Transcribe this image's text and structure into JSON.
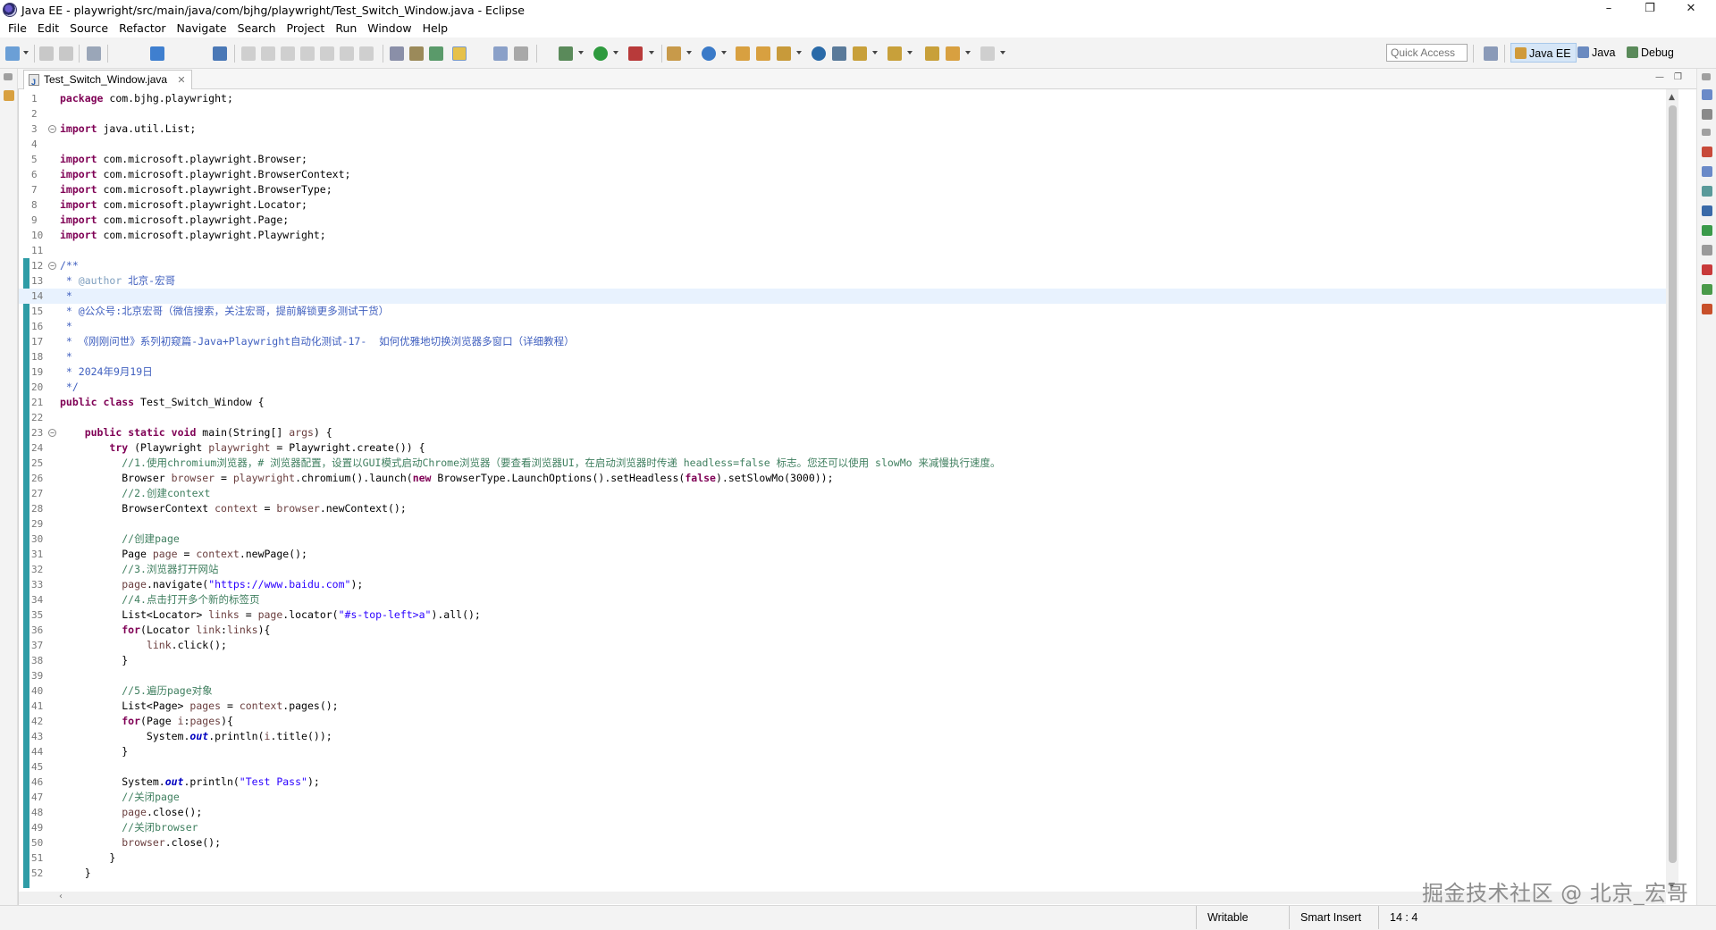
{
  "window": {
    "title": "Java EE - playwright/src/main/java/com/bjhg/playwright/Test_Switch_Window.java - Eclipse",
    "minimize_glyph": "–",
    "restore_glyph": "❐",
    "close_glyph": "✕"
  },
  "menu": [
    "File",
    "Edit",
    "Source",
    "Refactor",
    "Navigate",
    "Search",
    "Project",
    "Run",
    "Window",
    "Help"
  ],
  "toolbar": {
    "quick_access_placeholder": "Quick Access",
    "perspectives": [
      {
        "label": "Java EE",
        "icon": "java-ee-perspective-icon",
        "active": true
      },
      {
        "label": "Java",
        "icon": "java-perspective-icon",
        "active": false
      },
      {
        "label": "Debug",
        "icon": "debug-perspective-icon",
        "active": false
      }
    ]
  },
  "editor": {
    "tab_label": "Test_Switch_Window.java",
    "tab_close_glyph": "✕",
    "current_line": 14,
    "lines": [
      {
        "n": "1",
        "tokens": [
          [
            "kw",
            "package"
          ],
          [
            "",
            " com.bjhg.playwright;"
          ]
        ]
      },
      {
        "n": "2",
        "tokens": []
      },
      {
        "n": "3",
        "fold": true,
        "tokens": [
          [
            "kw",
            "import"
          ],
          [
            "",
            " java.util.List;"
          ]
        ]
      },
      {
        "n": "4",
        "tokens": []
      },
      {
        "n": "5",
        "tokens": [
          [
            "kw",
            "import"
          ],
          [
            "",
            " com.microsoft.playwright.Browser;"
          ]
        ]
      },
      {
        "n": "6",
        "tokens": [
          [
            "kw",
            "import"
          ],
          [
            "",
            " com.microsoft.playwright.BrowserContext;"
          ]
        ]
      },
      {
        "n": "7",
        "tokens": [
          [
            "kw",
            "import"
          ],
          [
            "",
            " com.microsoft.playwright.BrowserType;"
          ]
        ]
      },
      {
        "n": "8",
        "tokens": [
          [
            "kw",
            "import"
          ],
          [
            "",
            " com.microsoft.playwright.Locator;"
          ]
        ]
      },
      {
        "n": "9",
        "tokens": [
          [
            "kw",
            "import"
          ],
          [
            "",
            " com.microsoft.playwright.Page;"
          ]
        ]
      },
      {
        "n": "10",
        "tokens": [
          [
            "kw",
            "import"
          ],
          [
            "",
            " com.microsoft.playwright.Playwright;"
          ]
        ]
      },
      {
        "n": "11",
        "tokens": []
      },
      {
        "n": "12",
        "fold": true,
        "tokens": [
          [
            "jd",
            "/**"
          ]
        ]
      },
      {
        "n": "13",
        "tokens": [
          [
            "jd",
            " * "
          ],
          [
            "tag",
            "@author"
          ],
          [
            "jd",
            " 北京-宏哥"
          ]
        ]
      },
      {
        "n": "14",
        "tokens": [
          [
            "jd",
            " *"
          ]
        ]
      },
      {
        "n": "15",
        "tokens": [
          [
            "jd",
            " * @公众号:北京宏哥（微信搜索，关注宏哥，提前解锁更多测试干货）"
          ]
        ]
      },
      {
        "n": "16",
        "tokens": [
          [
            "jd",
            " *"
          ]
        ]
      },
      {
        "n": "17",
        "tokens": [
          [
            "jd",
            " * 《刚刚问世》系列初窥篇-Java+Playwright自动化测试-17-  如何优雅地切换浏览器多窗口（详细教程）"
          ]
        ]
      },
      {
        "n": "18",
        "tokens": [
          [
            "jd",
            " *"
          ]
        ]
      },
      {
        "n": "19",
        "tokens": [
          [
            "jd",
            " * 2024年9月19日"
          ]
        ]
      },
      {
        "n": "20",
        "tokens": [
          [
            "jd",
            " */"
          ]
        ]
      },
      {
        "n": "21",
        "tokens": [
          [
            "kw",
            "public"
          ],
          [
            "",
            " "
          ],
          [
            "kw",
            "class"
          ],
          [
            "",
            " Test_Switch_Window {"
          ]
        ]
      },
      {
        "n": "22",
        "tokens": []
      },
      {
        "n": "23",
        "fold": true,
        "tokens": [
          [
            "",
            "    "
          ],
          [
            "kw",
            "public"
          ],
          [
            "",
            " "
          ],
          [
            "kw",
            "static"
          ],
          [
            "",
            " "
          ],
          [
            "kw",
            "void"
          ],
          [
            "",
            " main(String[] "
          ],
          [
            "var",
            "args"
          ],
          [
            "",
            ") {"
          ]
        ]
      },
      {
        "n": "24",
        "tokens": [
          [
            "",
            "        "
          ],
          [
            "kw",
            "try"
          ],
          [
            "",
            " (Playwright "
          ],
          [
            "var",
            "playwright"
          ],
          [
            "",
            " = Playwright.create()) {"
          ]
        ]
      },
      {
        "n": "25",
        "tokens": [
          [
            "",
            "          "
          ],
          [
            "cm",
            "//1.使用chromium浏览器，# 浏览器配置，设置以GUI模式启动Chrome浏览器（要查看浏览器UI，在启动浏览器时传递 headless=false 标志。您还可以使用 slowMo 来减慢执行速度。"
          ]
        ]
      },
      {
        "n": "26",
        "tokens": [
          [
            "",
            "          Browser "
          ],
          [
            "var",
            "browser"
          ],
          [
            "",
            " = "
          ],
          [
            "var",
            "playwright"
          ],
          [
            "",
            ".chromium().launch("
          ],
          [
            "kw",
            "new"
          ],
          [
            "",
            " BrowserType.LaunchOptions().setHeadless("
          ],
          [
            "kw",
            "false"
          ],
          [
            "",
            ").setSlowMo(3000));"
          ]
        ]
      },
      {
        "n": "27",
        "tokens": [
          [
            "",
            "          "
          ],
          [
            "cm",
            "//2.创建context"
          ]
        ]
      },
      {
        "n": "28",
        "tokens": [
          [
            "",
            "          BrowserContext "
          ],
          [
            "var",
            "context"
          ],
          [
            "",
            " = "
          ],
          [
            "var",
            "browser"
          ],
          [
            "",
            ".newContext();"
          ]
        ]
      },
      {
        "n": "29",
        "tokens": []
      },
      {
        "n": "30",
        "tokens": [
          [
            "",
            "          "
          ],
          [
            "cm",
            "//创建page"
          ]
        ]
      },
      {
        "n": "31",
        "tokens": [
          [
            "",
            "          Page "
          ],
          [
            "var",
            "page"
          ],
          [
            "",
            " = "
          ],
          [
            "var",
            "context"
          ],
          [
            "",
            ".newPage();"
          ]
        ]
      },
      {
        "n": "32",
        "tokens": [
          [
            "",
            "          "
          ],
          [
            "cm",
            "//3.浏览器打开网站"
          ]
        ]
      },
      {
        "n": "33",
        "tokens": [
          [
            "",
            "          "
          ],
          [
            "var",
            "page"
          ],
          [
            "",
            ".navigate("
          ],
          [
            "str",
            "\"https://www.baidu.com\""
          ],
          [
            "",
            ");"
          ]
        ]
      },
      {
        "n": "34",
        "tokens": [
          [
            "",
            "          "
          ],
          [
            "cm",
            "//4.点击打开多个新的标签页"
          ]
        ]
      },
      {
        "n": "35",
        "tokens": [
          [
            "",
            "          List<Locator> "
          ],
          [
            "var",
            "links"
          ],
          [
            "",
            " = "
          ],
          [
            "var",
            "page"
          ],
          [
            "",
            ".locator("
          ],
          [
            "str",
            "\"#s-top-left>a\""
          ],
          [
            "",
            ").all();"
          ]
        ]
      },
      {
        "n": "36",
        "tokens": [
          [
            "",
            "          "
          ],
          [
            "kw",
            "for"
          ],
          [
            "",
            "(Locator "
          ],
          [
            "var",
            "link"
          ],
          [
            "",
            ":"
          ],
          [
            "var",
            "links"
          ],
          [
            "",
            "){"
          ]
        ]
      },
      {
        "n": "37",
        "tokens": [
          [
            "",
            "              "
          ],
          [
            "var",
            "link"
          ],
          [
            "",
            ".click();"
          ]
        ]
      },
      {
        "n": "38",
        "tokens": [
          [
            "",
            "          }"
          ]
        ]
      },
      {
        "n": "39",
        "tokens": []
      },
      {
        "n": "40",
        "tokens": [
          [
            "",
            "          "
          ],
          [
            "cm",
            "//5.遍历page对象"
          ]
        ]
      },
      {
        "n": "41",
        "tokens": [
          [
            "",
            "          List<Page> "
          ],
          [
            "var",
            "pages"
          ],
          [
            "",
            " = "
          ],
          [
            "var",
            "context"
          ],
          [
            "",
            ".pages();"
          ]
        ]
      },
      {
        "n": "42",
        "tokens": [
          [
            "",
            "          "
          ],
          [
            "kw",
            "for"
          ],
          [
            "",
            "(Page "
          ],
          [
            "var",
            "i"
          ],
          [
            "",
            ":"
          ],
          [
            "var",
            "pages"
          ],
          [
            "",
            "){"
          ]
        ]
      },
      {
        "n": "43",
        "tokens": [
          [
            "",
            "              System."
          ],
          [
            "fld",
            "out"
          ],
          [
            "",
            ".println("
          ],
          [
            "var",
            "i"
          ],
          [
            "",
            ".title());"
          ]
        ]
      },
      {
        "n": "44",
        "tokens": [
          [
            "",
            "          }"
          ]
        ]
      },
      {
        "n": "45",
        "tokens": []
      },
      {
        "n": "46",
        "tokens": [
          [
            "",
            "          System."
          ],
          [
            "fld",
            "out"
          ],
          [
            "",
            ".println("
          ],
          [
            "str",
            "\"Test Pass\""
          ],
          [
            "",
            ");"
          ]
        ]
      },
      {
        "n": "47",
        "tokens": [
          [
            "",
            "          "
          ],
          [
            "cm",
            "//关闭page"
          ]
        ]
      },
      {
        "n": "48",
        "tokens": [
          [
            "",
            "          "
          ],
          [
            "var",
            "page"
          ],
          [
            "",
            ".close();"
          ]
        ]
      },
      {
        "n": "49",
        "tokens": [
          [
            "",
            "          "
          ],
          [
            "cm",
            "//关闭browser"
          ]
        ]
      },
      {
        "n": "50",
        "tokens": [
          [
            "",
            "          "
          ],
          [
            "var",
            "browser"
          ],
          [
            "",
            ".close();"
          ]
        ]
      },
      {
        "n": "51",
        "tokens": [
          [
            "",
            "        }"
          ]
        ]
      },
      {
        "n": "52",
        "tokens": [
          [
            "",
            "    }"
          ]
        ]
      }
    ]
  },
  "status": {
    "writable": "Writable",
    "insert_mode": "Smart Insert",
    "position": "14 : 4"
  },
  "watermark": "掘金技术社区 @ 北京_宏哥",
  "colors": {
    "keyword": "#7f0055",
    "comment": "#3f7f5f",
    "javadoc": "#3f5fbf",
    "string": "#2a00ff",
    "variable": "#6a3e3e",
    "current_line": "#e8f2fe",
    "ruler": "#2e9ca6"
  }
}
